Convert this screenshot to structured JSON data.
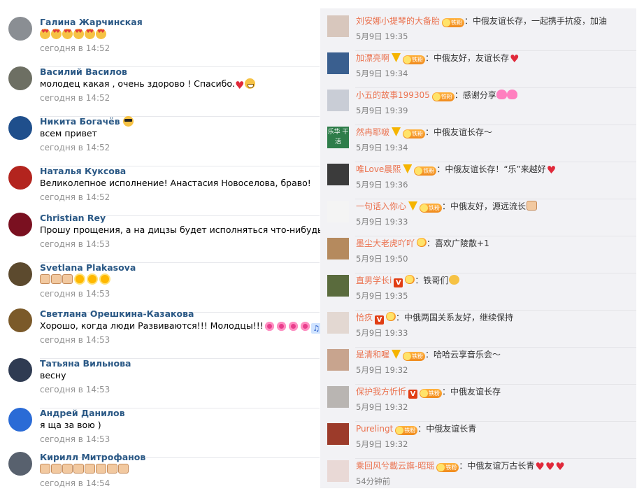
{
  "vk": {
    "comments": [
      {
        "name": "Галина Жарчинская",
        "text": "",
        "emoji": [
          "heart-eyes",
          "heart-eyes",
          "heart-eyes",
          "heart-eyes",
          "heart-eyes",
          "heart-eyes"
        ],
        "time": "сегодня в 14:52",
        "avatar_color": "#8a8e93"
      },
      {
        "name": "Василий Василов",
        "text": "молодец какая , очень здорово ! Спасибо.",
        "emoji": [
          "heart",
          "grin"
        ],
        "time": "сегодня в 14:52",
        "avatar_color": "#6d6f63"
      },
      {
        "name": "Никита Богачёв",
        "name_emoji": [
          "glasses"
        ],
        "text": "всем привет",
        "emoji": [],
        "time": "сегодня в 14:52",
        "avatar_color": "#1f4f8c"
      },
      {
        "name": "Наталья Куксова",
        "text": "Великолепное исполнение! Анастасия Новоселова, браво!",
        "emoji": [],
        "time": "сегодня в 14:52",
        "avatar_color": "#b3241e"
      },
      {
        "name": "Christian Rey",
        "text": "Прошу прощения, а на дицзы будет исполняться что-нибудь?",
        "emoji": [],
        "time": "сегодня в 14:53",
        "avatar_color": "#7a1020"
      },
      {
        "name": "Svetlana Plakasova",
        "text": "",
        "emoji": [
          "thumb",
          "thumb",
          "thumb",
          "sun",
          "sun",
          "sun"
        ],
        "time": "сегодня в 14:53",
        "avatar_color": "#5c4a2e"
      },
      {
        "name": "Светлана Орешкина-Казакова",
        "text": "Хорошо, когда люди Развиваются!!! Молодцы!!!",
        "emoji": [
          "flower",
          "flower",
          "flower",
          "flower",
          "music"
        ],
        "time": "сегодня в 14:53",
        "avatar_color": "#7b5a2a"
      },
      {
        "name": "Татьяна Вильнова",
        "text": "весну",
        "emoji": [],
        "time": "сегодня в 14:53",
        "avatar_color": "#2f3b52"
      },
      {
        "name": "Андрей Данилов",
        "text": "я ща за вою )",
        "emoji": [],
        "time": "сегодня в 14:53",
        "avatar_color": "#2a6bd6"
      },
      {
        "name": "Кирилл Митрофанов",
        "text": "",
        "emoji": [
          "thumb",
          "thumb",
          "thumb",
          "thumb",
          "thumb",
          "thumb",
          "thumb",
          "thumb"
        ],
        "time": "сегодня в 14:54",
        "avatar_color": "#58616e"
      }
    ]
  },
  "weibo": {
    "fan_label": "铁粉",
    "comments": [
      {
        "name": "刘安娜小提琴的大备胎",
        "vbadge": "",
        "fan": true,
        "text": "：中俄友谊长存，一起携手抗疫，加油",
        "emoji": [],
        "time": "5月9日 19:35",
        "avatar_color": "#d8c7bd"
      },
      {
        "name": "加漂亮啊",
        "vbadge": "gold",
        "fan": true,
        "text": "：中俄友好，友谊长存",
        "emoji": [
          "heart"
        ],
        "time": "5月9日 19:34",
        "avatar_color": "#3a5f8f"
      },
      {
        "name": "小五的故事199305",
        "vbadge": "",
        "fan": true,
        "text": "：感谢分享",
        "emoji": [
          "heart2",
          "heart2"
        ],
        "time": "5月9日 19:39",
        "avatar_color": "#c9cdd6"
      },
      {
        "name": "然冉耶啵",
        "vbadge": "gold",
        "fan": true,
        "text": "：中俄友谊长存～",
        "emoji": [],
        "time": "5月9日 19:34",
        "avatar_color": "#2e7d4a",
        "avatar_text": "乐华 干活"
      },
      {
        "name": "唯Love晨熙",
        "vbadge": "gold",
        "fan": true,
        "text": "：中俄友谊长存！“乐”来越好",
        "emoji": [
          "heart"
        ],
        "time": "5月9日 19:36",
        "avatar_color": "#3b3b3b"
      },
      {
        "name": "一句话入你心",
        "vbadge": "gold",
        "fan": true,
        "text": "：中俄友好，源远流长",
        "emoji": [
          "thumb"
        ],
        "time": "5月9日 19:33",
        "avatar_color": "#f4f4f4"
      },
      {
        "name": "墨尘大老虎吖吖",
        "vbadge": "",
        "fan": "nolabel",
        "text": "：喜欢广陵散+1",
        "emoji": [],
        "time": "5月9日 19:50",
        "avatar_color": "#b58a5e"
      },
      {
        "name": "直男学长i",
        "vbadge": "red",
        "fan": "nolabel",
        "text": "：铁哥们",
        "emoji": [
          "face"
        ],
        "time": "5月9日 19:35",
        "avatar_color": "#5a6b3d"
      },
      {
        "name": "恰疚",
        "vbadge": "red",
        "fan": "nolabel",
        "text": "：中俄两国关系友好，继续保持",
        "emoji": [],
        "time": "5月9日 19:33",
        "avatar_color": "#e3d8d2"
      },
      {
        "name": "是清和喔",
        "vbadge": "gold",
        "fan": true,
        "text": "：哈哈云享音乐会～",
        "emoji": [],
        "time": "5月9日 19:32",
        "avatar_color": "#c8a48e"
      },
      {
        "name": "保护我方忻忻",
        "vbadge": "red",
        "fan": true,
        "text": "：中俄友谊长存",
        "emoji": [],
        "time": "5月9日 19:32",
        "avatar_color": "#b9b5b2"
      },
      {
        "name": "Purelingt",
        "vbadge": "",
        "fan": true,
        "text": "：中俄友谊长青",
        "emoji": [],
        "time": "5月9日 19:32",
        "avatar_color": "#9c3b2a"
      },
      {
        "name": "乘回风兮載云旗-昭瑶",
        "vbadge": "",
        "fan": true,
        "text": "：中俄友谊万古长青",
        "emoji": [
          "heart",
          "heart",
          "heart"
        ],
        "time": "54分钟前",
        "avatar_color": "#e9d9d6"
      }
    ]
  }
}
